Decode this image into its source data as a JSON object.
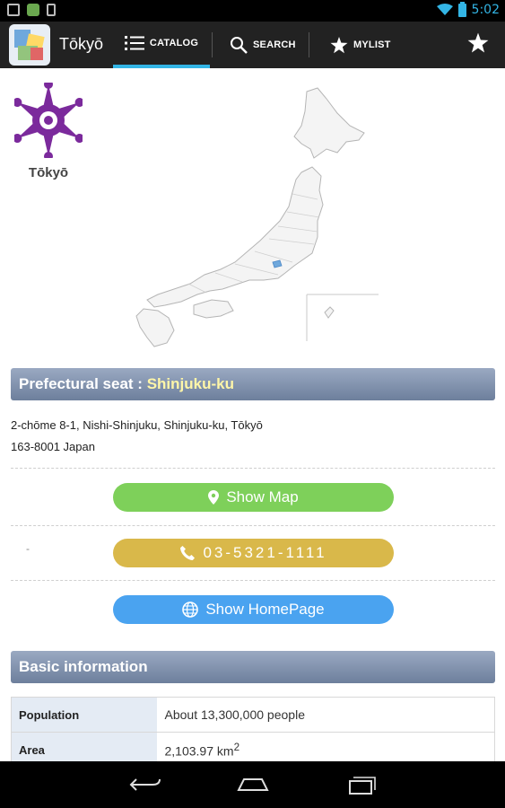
{
  "status_bar": {
    "time": "5:02"
  },
  "action_bar": {
    "title": "Tōkyō",
    "tabs": [
      {
        "label": "CATALOG",
        "icon": "list-icon",
        "active": true
      },
      {
        "label": "SEARCH",
        "icon": "search-icon"
      },
      {
        "label": "MYLIST",
        "icon": "star-icon"
      }
    ],
    "overflow_icon": "star-icon"
  },
  "prefecture": {
    "name": "Tōkyō",
    "emblem_color": "#7b2a9c"
  },
  "seat": {
    "label": "Prefectural seat : ",
    "value": "Shinjuku-ku",
    "address_line1": "2-chōme 8-1, Nishi-Shinjuku, Shinjuku-ku, Tōkyō",
    "address_line2": "163-8001 Japan"
  },
  "actions": {
    "show_map": "Show Map",
    "phone": "03-5321-1111",
    "show_homepage": "Show HomePage",
    "minus_mark": "-"
  },
  "basic_info": {
    "header": "Basic information",
    "rows": [
      {
        "key": "Population",
        "value": "About 13,300,000 people"
      },
      {
        "key": "Area",
        "value": "2,103.97 km",
        "superscript": "2"
      }
    ]
  },
  "colors": {
    "accent": "#33b5e5",
    "map_button": "#7ed05a",
    "phone_button": "#d9b84a",
    "homepage_button": "#4aa3f0",
    "header_bar": "#7d8da8"
  }
}
